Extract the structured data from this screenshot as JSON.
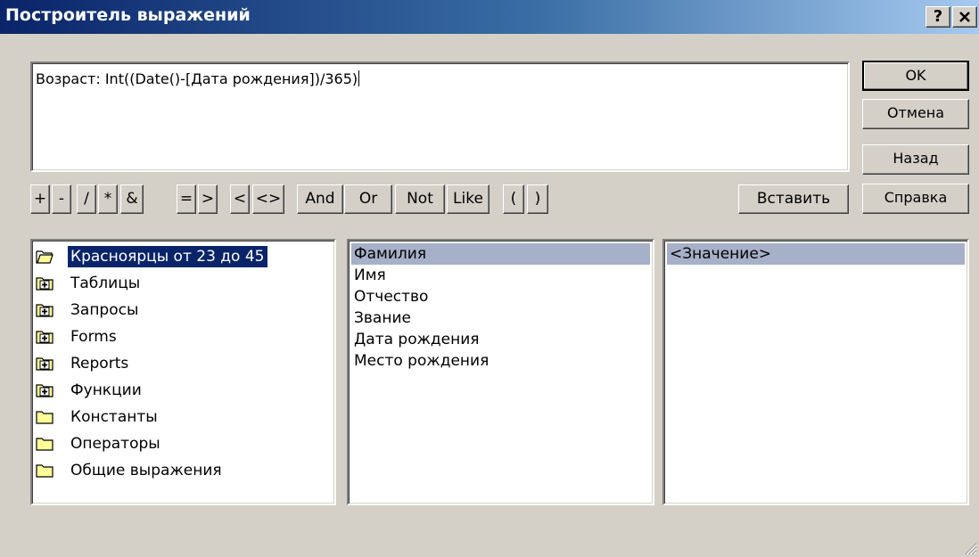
{
  "window": {
    "title": "Построитель выражений",
    "help_button": "?",
    "close_button": "✕"
  },
  "expression": {
    "value": "Возраст: Int((Date()-[Дата рождения])/365)"
  },
  "side_buttons": {
    "ok": "OK",
    "cancel": "Отмена",
    "back": "Назад",
    "help": "Справка"
  },
  "operators": [
    "+",
    "-",
    "/",
    "*",
    "&",
    "=",
    ">",
    "<",
    "<>",
    "And",
    "Or",
    "Not",
    "Like",
    "(",
    ")"
  ],
  "insert_button": "Вставить",
  "tree": {
    "items": [
      {
        "label": "Красноярцы от 23 до 45",
        "icon": "open-folder-icon",
        "selected": true
      },
      {
        "label": "Таблицы",
        "icon": "expand-folder-icon"
      },
      {
        "label": "Запросы",
        "icon": "expand-folder-icon"
      },
      {
        "label": "Forms",
        "icon": "expand-folder-icon"
      },
      {
        "label": "Reports",
        "icon": "expand-folder-icon"
      },
      {
        "label": "Функции",
        "icon": "expand-folder-icon"
      },
      {
        "label": "Константы",
        "icon": "folder-icon"
      },
      {
        "label": "Операторы",
        "icon": "folder-icon"
      },
      {
        "label": "Общие выражения",
        "icon": "folder-icon"
      }
    ]
  },
  "fields": {
    "items": [
      "Фамилия",
      "Имя",
      "Отчество",
      "Звание",
      "Дата рождения",
      "Место рождения"
    ],
    "highlighted_index": 0
  },
  "values": {
    "items": [
      "<Значение>"
    ],
    "highlighted_index": 0
  },
  "colors": {
    "selection": "#0a246a",
    "highlight": "#a6b0c8",
    "face": "#d4d0c8"
  }
}
